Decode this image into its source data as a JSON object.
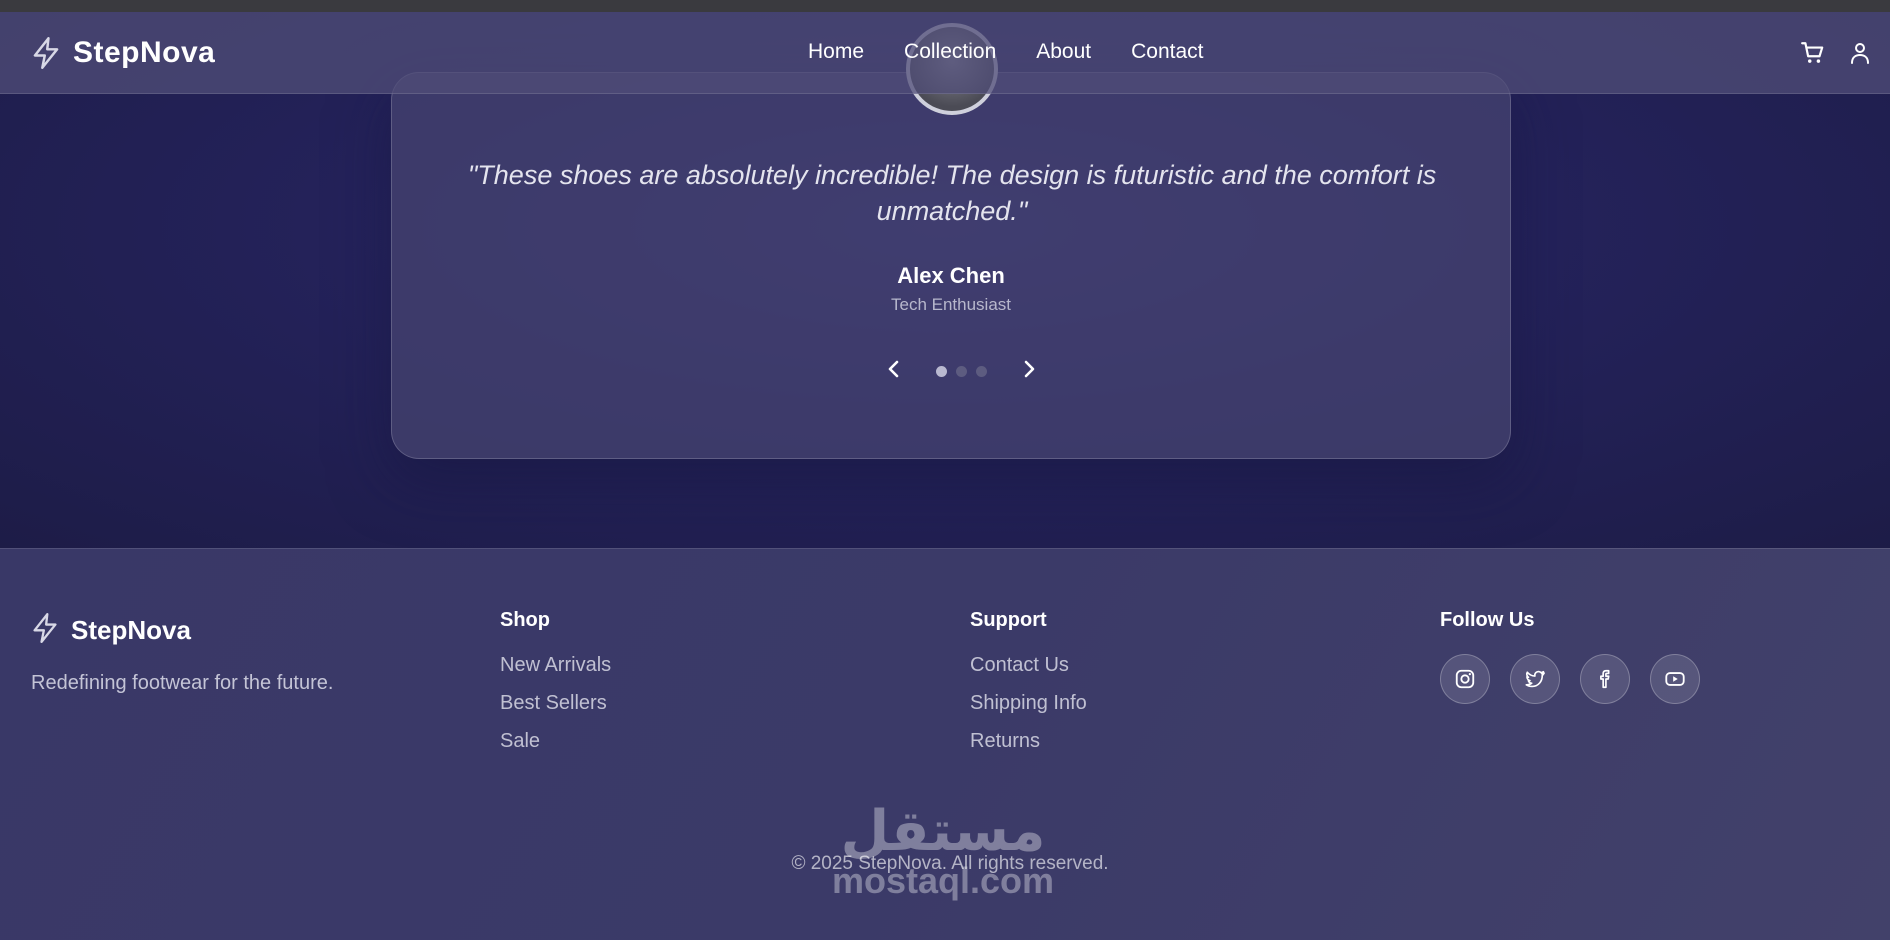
{
  "brand": {
    "name": "StepNova"
  },
  "nav": {
    "links": [
      "Home",
      "Collection",
      "About",
      "Contact"
    ],
    "actions": [
      {
        "icon": "cart-icon"
      },
      {
        "icon": "user-icon"
      }
    ]
  },
  "testimonial": {
    "quote": "\"These shoes are absolutely incredible! The design is futuristic and the comfort is unmatched.\"",
    "author": "Alex Chen",
    "role": "Tech Enthusiast",
    "total_slides": 3,
    "active_slide": 1
  },
  "footer": {
    "brand_name": "StepNova",
    "tagline": "Redefining footwear for the future.",
    "shop": {
      "title": "Shop",
      "links": [
        "New Arrivals",
        "Best Sellers",
        "Sale"
      ]
    },
    "support": {
      "title": "Support",
      "links": [
        "Contact Us",
        "Shipping Info",
        "Returns"
      ]
    },
    "follow": {
      "title": "Follow Us",
      "socials": [
        "instagram-icon",
        "twitter-icon",
        "facebook-icon",
        "youtube-icon"
      ]
    },
    "copyright": "© 2025 StepNova. All rights reserved."
  },
  "watermark": {
    "arabic": "مستقل",
    "latin": "mostaql.com"
  },
  "colors": {
    "hero_bg": "#24225a",
    "footer_bg": "#3b3a68",
    "text_muted": "#c0c0d2",
    "dot_active": "#b9b9d0"
  }
}
